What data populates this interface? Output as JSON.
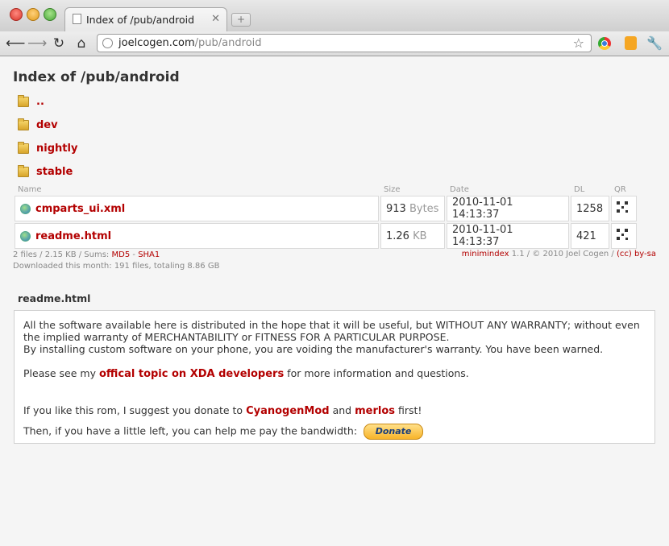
{
  "browser": {
    "tab_title": "Index of /pub/android",
    "tab_close": "✕",
    "new_tab": "+",
    "url_host": "joelcogen.com",
    "url_path": "/pub/android"
  },
  "page": {
    "heading": "Index of /pub/android",
    "directories": [
      "..",
      "dev",
      "nightly",
      "stable"
    ],
    "columns": {
      "name": "Name",
      "size": "Size",
      "date": "Date",
      "dl": "DL",
      "qr": "QR"
    },
    "files": [
      {
        "name": "cmparts_ui.xml",
        "size": "913",
        "unit": "Bytes",
        "date": "2010-11-01 14:13:37",
        "dl": "1258"
      },
      {
        "name": "readme.html",
        "size": "1.26",
        "unit": "KB",
        "date": "2010-11-01 14:13:37",
        "dl": "421"
      }
    ],
    "summary_prefix": "2 files / 2.15 KB / Sums:",
    "md5": "MD5",
    "dash": "-",
    "sha1": "SHA1",
    "downloads_line": "Downloaded this month: 191 files, totaling 8.86 GB",
    "credit_link": "minimindex",
    "credit_text": "1.1 / © 2010 Joel Cogen /",
    "license_link": "(cc) by-sa"
  },
  "readme": {
    "title": "readme.html",
    "line1": "All the software available here is distributed in the hope that it will be useful, but WITHOUT ANY WARRANTY; without even the implied warranty of MERCHANTABILITY or FITNESS FOR A PARTICULAR PURPOSE.",
    "line2": "By installing custom software on your phone, you are voiding the manufacturer's warranty. You have been warned.",
    "topic_prefix": "Please see my",
    "topic_link": "offical topic on XDA developers",
    "topic_suffix": "for more information and questions.",
    "donate_prefix": "If you like this rom, I suggest you donate to",
    "donate_link1": "CyanogenMod",
    "donate_and": "and",
    "donate_link2": "merlos",
    "donate_suffix": "first!",
    "bandwidth_text": "Then, if you have a little left, you can help me pay the bandwidth:",
    "donate_button": "Donate"
  }
}
